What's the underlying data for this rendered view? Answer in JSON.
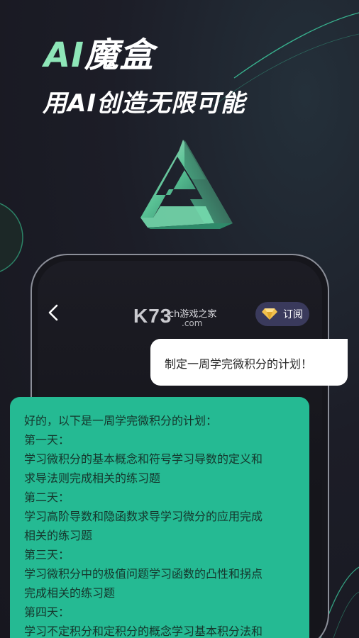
{
  "hero": {
    "title_ai": "AI",
    "title_rest": "魔盒",
    "subtitle": "用AI创造无限可能"
  },
  "chat_header": {
    "back_icon": "chevron-left-icon",
    "watermark_main": "K73",
    "watermark_top": "ch游戏之家",
    "watermark_com": ".com",
    "subscribe_label": "订阅",
    "subscribe_icon": "diamond-icon"
  },
  "user_message": "制定一周学完微积分的计划！",
  "ai_message": {
    "lines": [
      "好的，以下是一周学完微积分的计划：",
      "第一天：",
      "学习微积分的基本概念和符号学习导数的定义和",
      "求导法则完成相关的练习题",
      "第二天：",
      "学习高阶导数和隐函数求导学习微分的应用完成",
      "相关的练习题",
      "第三天：",
      "学习微积分中的极值问题学习函数的凸性和拐点",
      "完成相关的练习题",
      "第四天：",
      "学习不定积分和定积分的概念学习基本积分法和"
    ]
  },
  "colors": {
    "accent_green": "#25ba93",
    "title_green": "#8ee6b8",
    "subscribe_bg": "#3a3a5c",
    "gem_gold": "#f2c14e"
  }
}
